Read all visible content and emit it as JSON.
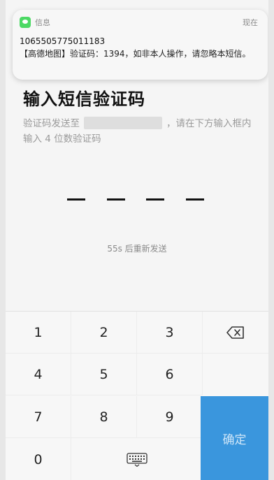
{
  "notification": {
    "app": "信息",
    "time": "现在",
    "sender": "1065505775011183",
    "body": "【高德地图】验证码：1394，如非本人操作，请忽略本短信。"
  },
  "page": {
    "title": "输入短信验证码",
    "subtitle_prefix": "验证码发送至",
    "subtitle_suffix": "，请在下方输入框内输入 4 位数验证码",
    "resend": "55s 后重新发送"
  },
  "keypad": {
    "keys": [
      "1",
      "2",
      "3",
      "4",
      "5",
      "6",
      "7",
      "8",
      "9",
      "0"
    ],
    "confirm": "确定"
  },
  "colors": {
    "confirm_bg": "#3a96dd",
    "notif_icon": "#4cd964"
  }
}
